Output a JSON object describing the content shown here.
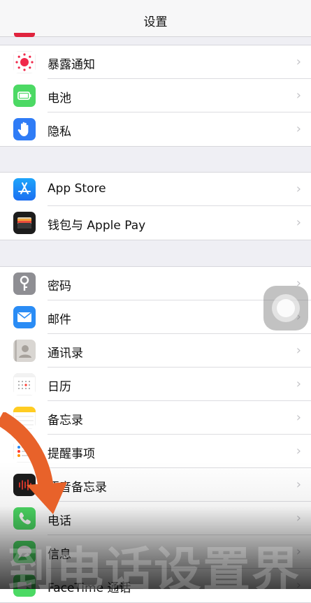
{
  "navbar": {
    "title": "设置"
  },
  "group1": [
    {
      "label": "暴露通知",
      "icon": "exposure-notification-icon"
    },
    {
      "label": "电池",
      "icon": "battery-icon"
    },
    {
      "label": "隐私",
      "icon": "privacy-hand-icon"
    }
  ],
  "group2": [
    {
      "label": "App Store",
      "icon": "app-store-icon"
    },
    {
      "label": "钱包与 Apple Pay",
      "icon": "wallet-icon"
    }
  ],
  "group3": [
    {
      "label": "密码",
      "icon": "key-icon"
    },
    {
      "label": "邮件",
      "icon": "mail-icon"
    },
    {
      "label": "通讯录",
      "icon": "contacts-icon"
    },
    {
      "label": "日历",
      "icon": "calendar-icon"
    },
    {
      "label": "备忘录",
      "icon": "notes-icon"
    },
    {
      "label": "提醒事项",
      "icon": "reminders-icon"
    },
    {
      "label": "语音备忘录",
      "icon": "voice-memos-icon"
    },
    {
      "label": "电话",
      "icon": "phone-icon"
    },
    {
      "label": "信息",
      "icon": "messages-icon"
    },
    {
      "label": "FaceTime 通话",
      "icon": "facetime-icon"
    }
  ],
  "chevron": "›",
  "caption": "到电话设置界",
  "colors": {
    "arrow": "#e8622a",
    "background": "#efeff4"
  }
}
